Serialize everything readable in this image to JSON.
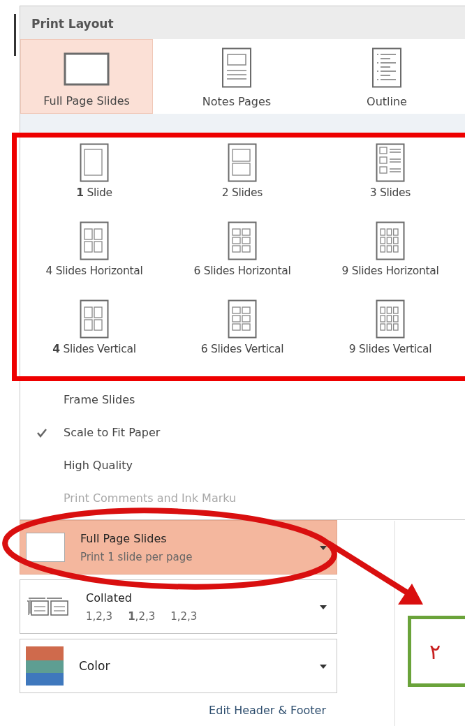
{
  "print_layout": {
    "title": "Print Layout",
    "items": [
      {
        "label": "Full Page Slides",
        "selected": true
      },
      {
        "label": "Notes Pages",
        "selected": false
      },
      {
        "label": "Outline",
        "selected": false
      }
    ]
  },
  "handouts": {
    "items": [
      {
        "label": "**1** Slide",
        "selected": false
      },
      {
        "label": "2 Slides",
        "selected": false
      },
      {
        "label": "3 Slides",
        "selected": false
      },
      {
        "label": "4 Slides Horizontal",
        "selected": false
      },
      {
        "label": "6 Slides Horizontal",
        "selected": false
      },
      {
        "label": "9 Slides Horizontal",
        "selected": false
      },
      {
        "label": "**4** Slides Vertical",
        "selected": false
      },
      {
        "label": "6 Slides Vertical",
        "selected": false
      },
      {
        "label": "9 Slides Vertical",
        "selected": false
      }
    ]
  },
  "options": [
    {
      "label": "Frame Slides",
      "checked": false,
      "disabled": false
    },
    {
      "label": "Scale to Fit Paper",
      "checked": true,
      "disabled": false
    },
    {
      "label": "High Quality",
      "checked": false,
      "disabled": false
    },
    {
      "label": "Print Comments and Ink Marku",
      "checked": false,
      "disabled": true
    }
  ],
  "settings": [
    {
      "kind": "layout",
      "title": "Full Page Slides",
      "subtitle": "Print 1 slide per page",
      "selected": true
    },
    {
      "kind": "collate",
      "title": "Collated",
      "groups": [
        "1,2,3",
        "**1**,2,3",
        "1,2,3"
      ],
      "selected": false
    },
    {
      "kind": "color",
      "title": "Color",
      "selected": false
    }
  ],
  "footer_link": "Edit Header & Footer",
  "annotation": {
    "label": "۲"
  }
}
